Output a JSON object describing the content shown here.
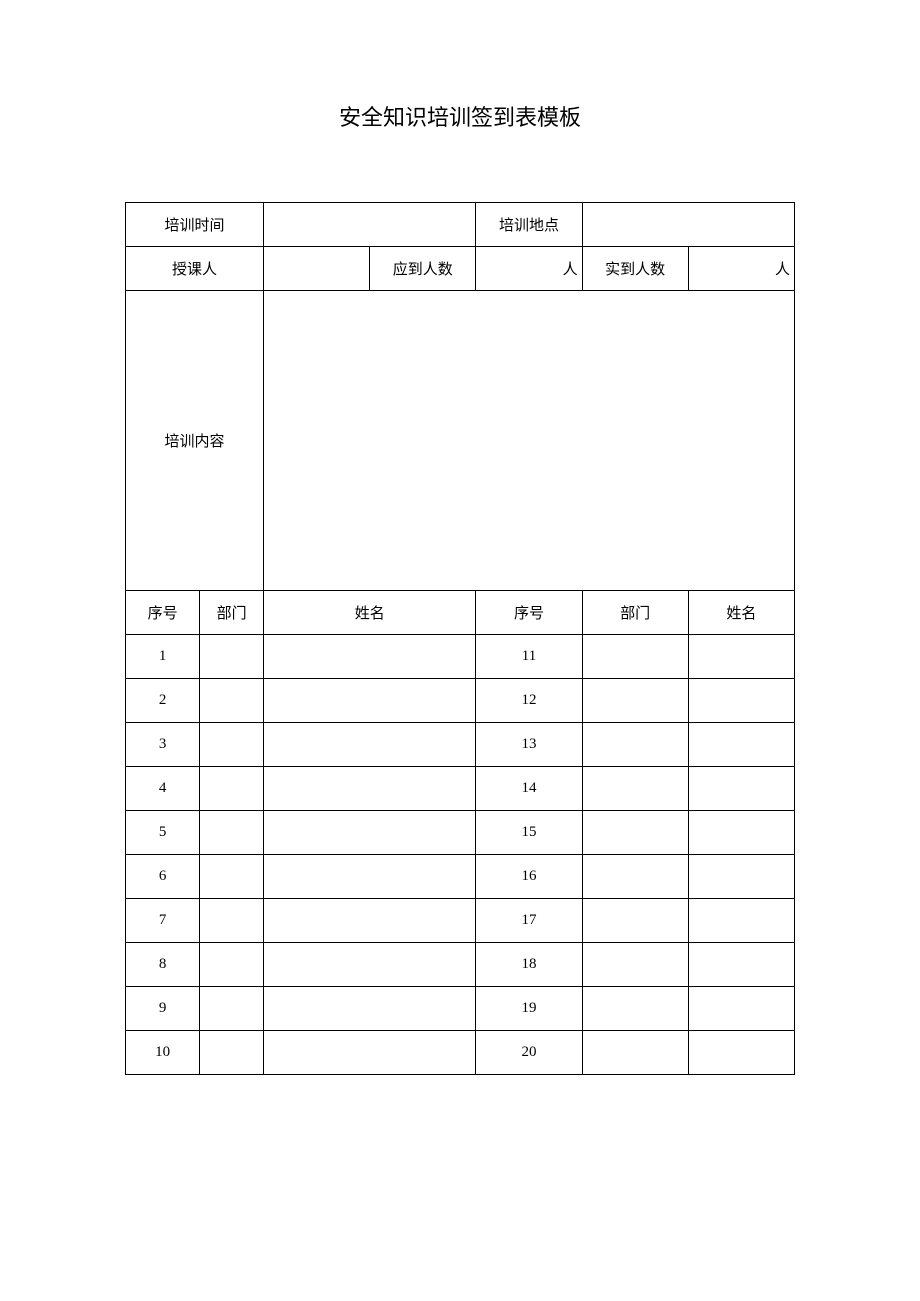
{
  "title": "安全知识培训签到表模板",
  "labels": {
    "training_time": "培训时间",
    "training_location": "培训地点",
    "instructor": "授课人",
    "expected_count": "应到人数",
    "actual_count": "实到人数",
    "person_unit": "人",
    "training_content": "培训内容",
    "seq": "序号",
    "department": "部门",
    "name": "姓名"
  },
  "fields": {
    "training_time": "",
    "training_location": "",
    "instructor": "",
    "expected_count": "",
    "actual_count": "",
    "training_content": ""
  },
  "rows_left": [
    {
      "seq": "1",
      "department": "",
      "name": ""
    },
    {
      "seq": "2",
      "department": "",
      "name": ""
    },
    {
      "seq": "3",
      "department": "",
      "name": ""
    },
    {
      "seq": "4",
      "department": "",
      "name": ""
    },
    {
      "seq": "5",
      "department": "",
      "name": ""
    },
    {
      "seq": "6",
      "department": "",
      "name": ""
    },
    {
      "seq": "7",
      "department": "",
      "name": ""
    },
    {
      "seq": "8",
      "department": "",
      "name": ""
    },
    {
      "seq": "9",
      "department": "",
      "name": ""
    },
    {
      "seq": "10",
      "department": "",
      "name": ""
    }
  ],
  "rows_right": [
    {
      "seq": "11",
      "department": "",
      "name": ""
    },
    {
      "seq": "12",
      "department": "",
      "name": ""
    },
    {
      "seq": "13",
      "department": "",
      "name": ""
    },
    {
      "seq": "14",
      "department": "",
      "name": ""
    },
    {
      "seq": "15",
      "department": "",
      "name": ""
    },
    {
      "seq": "16",
      "department": "",
      "name": ""
    },
    {
      "seq": "17",
      "department": "",
      "name": ""
    },
    {
      "seq": "18",
      "department": "",
      "name": ""
    },
    {
      "seq": "19",
      "department": "",
      "name": ""
    },
    {
      "seq": "20",
      "department": "",
      "name": ""
    }
  ]
}
